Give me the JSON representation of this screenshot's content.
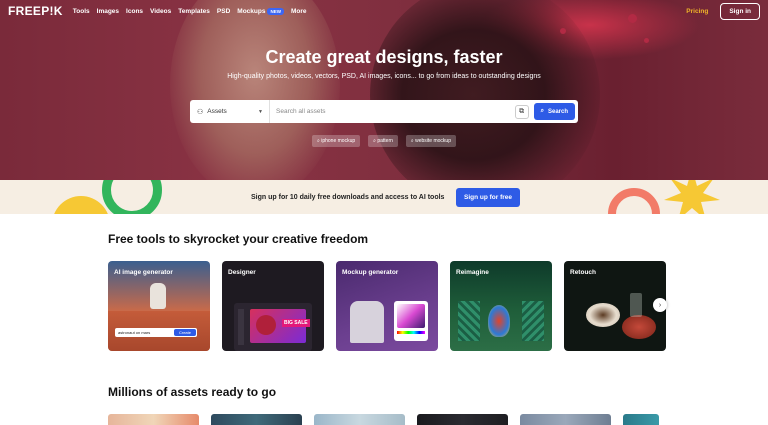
{
  "nav": {
    "logo": "FREEP!K",
    "items": [
      "Tools",
      "Images",
      "Icons",
      "Videos",
      "Templates",
      "PSD",
      "Mockups",
      "More"
    ],
    "mockups_badge": "NEW",
    "pricing": "Pricing",
    "sign_in": "Sign in"
  },
  "hero": {
    "title": "Create great designs, faster",
    "subtitle": "High-quality photos, videos, vectors, PSD, AI images, icons... to go from ideas to outstanding designs",
    "search": {
      "category": "Assets",
      "placeholder": "Search all assets",
      "button": "Search"
    },
    "chips": [
      "iphone mockup",
      "pattern",
      "website mockup"
    ]
  },
  "banner": {
    "text": "Sign up for 10 daily free downloads and access to AI tools",
    "button": "Sign up for free"
  },
  "tools": {
    "title": "Free tools to skyrocket your creative freedom",
    "cards": [
      {
        "label": "AI image generator",
        "prompt": "astronaut on mars",
        "action": "Create"
      },
      {
        "label": "Designer",
        "sale_text": "BIG SALE"
      },
      {
        "label": "Mockup generator"
      },
      {
        "label": "Reimagine"
      },
      {
        "label": "Retouch"
      }
    ]
  },
  "assets": {
    "title": "Millions of assets ready to go"
  },
  "colors": {
    "accent_blue": "#2e5be6",
    "pricing_gold": "#f0b429",
    "hero_bg": "#7a2a3a",
    "banner_bg": "#f6eee3"
  }
}
